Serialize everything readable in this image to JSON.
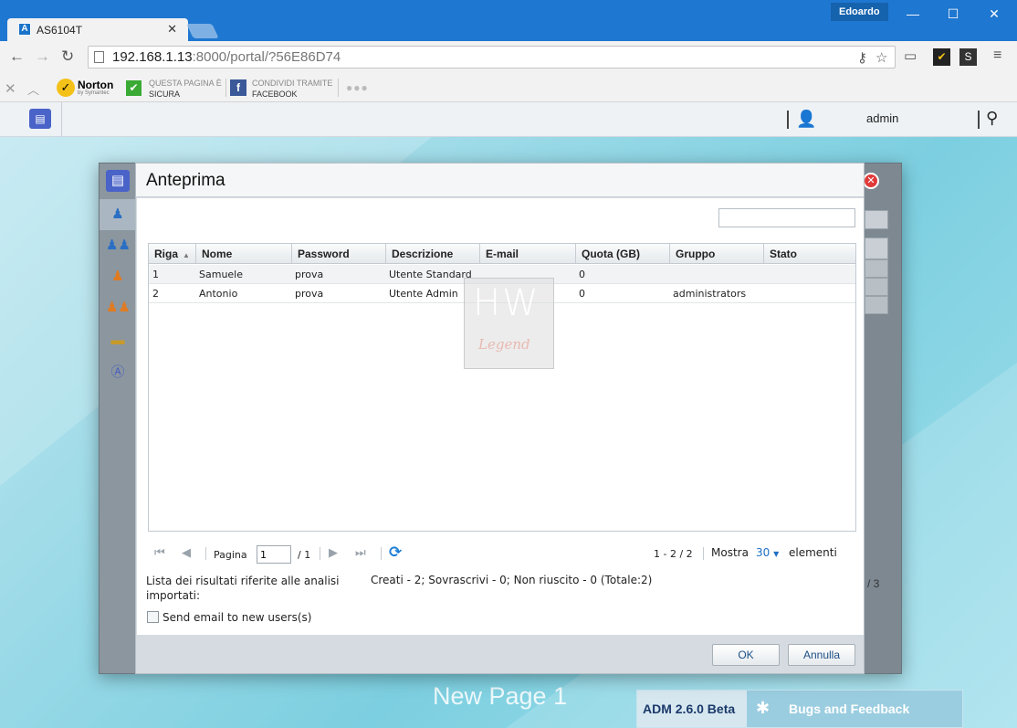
{
  "browser": {
    "tab_title": "AS6104T",
    "profile_name": "Edoardo",
    "url_host": "192.168.1.13",
    "url_port_path": ":8000/portal/?56E86D74",
    "window_controls": [
      "—",
      "☐",
      "✕"
    ]
  },
  "bookmarks": {
    "norton_name": "Norton",
    "norton_by": "by Symantec",
    "safe_line1": "QUESTA PAGINA È",
    "safe_line2": "SICURA",
    "share_line1": "CONDIVIDI TRAMITE",
    "share_line2": "FACEBOOK"
  },
  "adm": {
    "username": "admin",
    "new_page_label": "New Page 1",
    "version_label": "ADM 2.6.0 Beta",
    "bugs_label": "Bugs and Feedback",
    "bg_pager_text": "/ 3"
  },
  "dialog": {
    "title": "Anteprima",
    "columns": [
      "Riga",
      "Nome",
      "Password",
      "Descrizione",
      "E-mail",
      "Quota (GB)",
      "Gruppo",
      "Stato"
    ],
    "rows": [
      {
        "riga": "1",
        "nome": "Samuele",
        "password": "prova",
        "descrizione": "Utente Standard",
        "email": "",
        "quota": "0",
        "gruppo": "",
        "stato": ""
      },
      {
        "riga": "2",
        "nome": "Antonio",
        "password": "prova",
        "descrizione": "Utente Admin",
        "email": "",
        "quota": "0",
        "gruppo": "administrators",
        "stato": ""
      }
    ],
    "pager": {
      "page_label": "Pagina",
      "page_value": "1",
      "page_total": "/ 1",
      "range": "1 - 2 / 2",
      "show_label": "Mostra",
      "page_size": "30",
      "items_label": "elementi"
    },
    "summary_label": "Lista dei risultati riferite alle analisi importati:",
    "summary_value": "Creati - 2; Sovrascrivi - 0; Non riuscito - 0 (Totale:2)",
    "send_email_label": "Send email to new users(s)",
    "send_email_checked": false,
    "ok_label": "OK",
    "cancel_label": "Annulla"
  },
  "watermark": {
    "big": "HW",
    "small": "Legend"
  },
  "colors": {
    "chrome_blue": "#1e77d0",
    "close_red": "#e03a3a",
    "refresh_blue": "#1e7fd6",
    "button_text": "#1b4f86"
  }
}
